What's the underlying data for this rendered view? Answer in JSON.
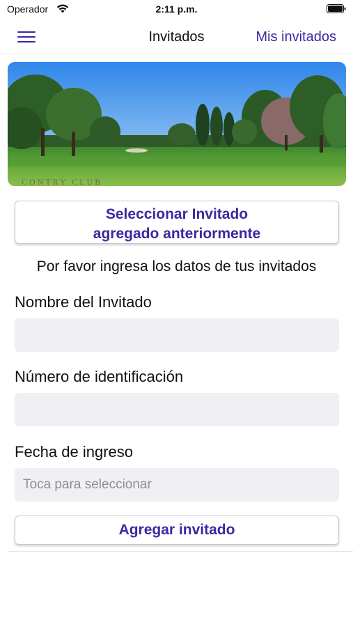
{
  "status_bar": {
    "carrier": "Operador",
    "time": "2:11 p.m.",
    "icons": [
      "wifi-icon",
      "battery-icon"
    ]
  },
  "nav": {
    "menu_icon": "hamburger-menu-icon",
    "title": "Invitados",
    "right_link": "Mis invitados"
  },
  "banner": {
    "description_icon": "golf-course-photo",
    "sign_text": "CONTRY CLUB"
  },
  "select_button": {
    "line1": "Seleccionar Invitado",
    "line2": "agregado anteriormente"
  },
  "instructions": "Por favor ingresa los datos de tus invitados",
  "form": {
    "name_label": "Nombre del Invitado",
    "name_value": "",
    "id_label": "Número de identificación",
    "id_value": "",
    "date_label": "Fecha de ingreso",
    "date_placeholder": "Toca para seleccionar"
  },
  "add_button": "Agregar invitado",
  "colors": {
    "accent": "#3a29a0",
    "input_bg": "#efeff4",
    "placeholder": "#8e8e93"
  }
}
